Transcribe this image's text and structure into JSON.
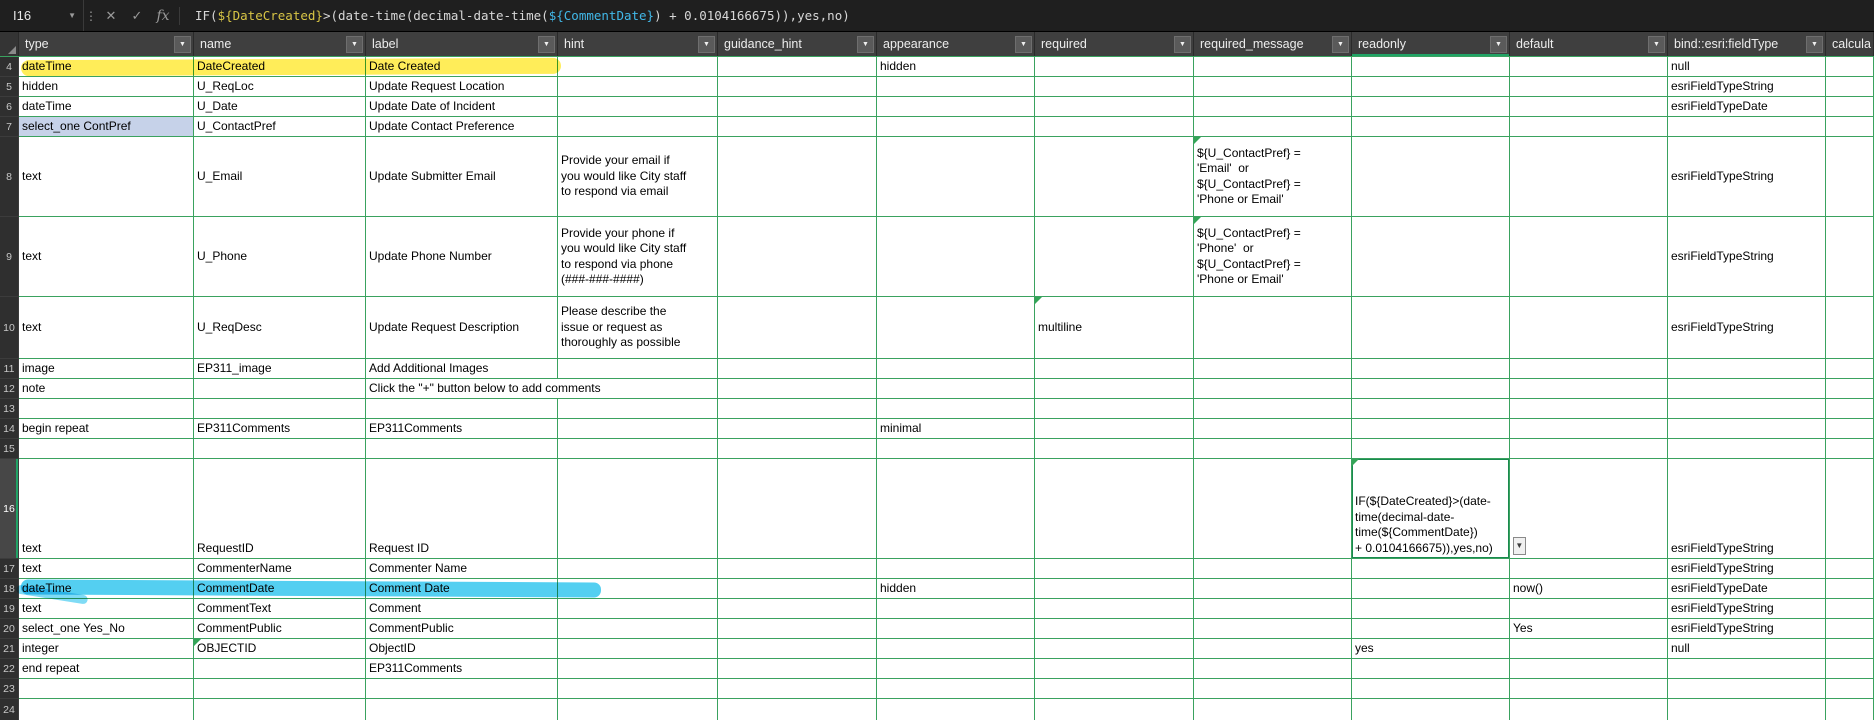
{
  "colors": {
    "grid_line": "#3aa25f",
    "yellow_marker": "#ffe619",
    "blue_marker": "#29c3ee",
    "formula_ref_datecreated": "#d8c545",
    "formula_ref_commentdate": "#41b8e8"
  },
  "formula_bar": {
    "cell_reference": "I16",
    "name_box_chevron": "▼",
    "menu_icon": "⋮",
    "cancel_icon": "✕",
    "confirm_icon": "✓",
    "function_icon": "fx",
    "formula": {
      "part1": "IF(",
      "highlight1": "${DateCreated}",
      "part2": ">(date-time(decimal-date-time(",
      "highlight2": "${CommentDate}",
      "part3": ") + 0.0104166675)),yes,no)"
    }
  },
  "header": {
    "filter_icon": "▼",
    "columns": [
      "type",
      "name",
      "label",
      "hint",
      "guidance_hint",
      "appearance",
      "required",
      "required_message",
      "readonly",
      "default",
      "bind::esri:fieldType",
      "calcula"
    ]
  },
  "sheet": {
    "validation_icon": "▼"
  },
  "rows": [
    {
      "num": "4",
      "marker": "yellow",
      "cells": [
        "dateTime",
        "DateCreated",
        "Date Created",
        "",
        "",
        "hidden",
        "",
        "",
        "",
        "",
        "null",
        ""
      ]
    },
    {
      "num": "5",
      "cells": [
        "hidden",
        "U_ReqLoc",
        "Update Request Location",
        "",
        "",
        "",
        "",
        "",
        "",
        "",
        "esriFieldTypeString",
        ""
      ]
    },
    {
      "num": "6",
      "cells": [
        "dateTime",
        "U_Date",
        "Update Date of Incident",
        "",
        "",
        "",
        "",
        "",
        "",
        "",
        "esriFieldTypeDate",
        ""
      ]
    },
    {
      "num": "7",
      "selected_type_cell": true,
      "cells": [
        "select_one ContPref",
        "U_ContactPref",
        "Update Contact Preference",
        "",
        "",
        "",
        "",
        "",
        "",
        "",
        "",
        ""
      ]
    },
    {
      "num": "8",
      "flags": [
        7
      ],
      "cells": [
        "text",
        "U_Email",
        "Update Submitter Email",
        "Provide your email if\nyou would like City staff\nto respond via email",
        "",
        "",
        "",
        "${U_ContactPref} =\n'Email'  or\n${U_ContactPref} =\n'Phone or Email'",
        "",
        "",
        "esriFieldTypeString",
        ""
      ]
    },
    {
      "num": "9",
      "flags": [
        7
      ],
      "cells": [
        "text",
        "U_Phone",
        "Update Phone Number",
        "Provide your phone if\nyou would like City staff\nto respond via phone\n(###-###-####)",
        "",
        "",
        "",
        "${U_ContactPref} =\n'Phone'  or\n${U_ContactPref} =\n'Phone or Email'",
        "",
        "",
        "esriFieldTypeString",
        ""
      ]
    },
    {
      "num": "10",
      "flags": [
        6
      ],
      "cells": [
        "text",
        "U_ReqDesc",
        "Update Request Description",
        "Please describe the\nissue or request as\nthoroughly as possible",
        "",
        "",
        "multiline",
        "",
        "",
        "",
        "esriFieldTypeString",
        ""
      ]
    },
    {
      "num": "11",
      "cells": [
        "image",
        "EP311_image",
        "Add Additional Images",
        "",
        "",
        "",
        "",
        "",
        "",
        "",
        "",
        ""
      ]
    },
    {
      "num": "12",
      "colspan": {
        "2": 2
      },
      "cells": [
        "note",
        "",
        "Click the \"+\" button below to add comments",
        "",
        "",
        "",
        "",
        "",
        "",
        "",
        "",
        ""
      ]
    },
    {
      "num": "13",
      "cells": [
        "",
        "",
        "",
        "",
        "",
        "",
        "",
        "",
        "",
        "",
        "",
        ""
      ]
    },
    {
      "num": "14",
      "cells": [
        "begin repeat",
        "EP311Comments",
        "EP311Comments",
        "",
        "",
        "minimal",
        "",
        "",
        "",
        "",
        "",
        ""
      ]
    },
    {
      "num": "15",
      "cells": [
        "",
        "",
        "",
        "",
        "",
        "",
        "",
        "",
        "",
        "",
        "",
        ""
      ]
    },
    {
      "num": "16",
      "active": true,
      "flags": [
        8
      ],
      "cells": [
        "text",
        "RequestID",
        "Request ID",
        "",
        "",
        "",
        "",
        "",
        "IF(${DateCreated}>(date-\ntime(decimal-date-\ntime(${CommentDate})\n+ 0.0104166675)),yes,no)",
        "",
        "esriFieldTypeString",
        ""
      ]
    },
    {
      "num": "17",
      "cells": [
        "text",
        "CommenterName",
        "Commenter Name",
        "",
        "",
        "",
        "",
        "",
        "",
        "",
        "esriFieldTypeString",
        ""
      ]
    },
    {
      "num": "18",
      "marker": "blue",
      "cells": [
        "dateTime",
        "CommentDate",
        "Comment Date",
        "",
        "",
        "hidden",
        "",
        "",
        "",
        "now()",
        "esriFieldTypeDate",
        ""
      ]
    },
    {
      "num": "19",
      "cells": [
        "text",
        "CommentText",
        "Comment",
        "",
        "",
        "",
        "",
        "",
        "",
        "",
        "esriFieldTypeString",
        ""
      ]
    },
    {
      "num": "20",
      "cells": [
        "select_one Yes_No",
        "CommentPublic",
        "CommentPublic",
        "",
        "",
        "",
        "",
        "",
        "",
        "Yes",
        "esriFieldTypeString",
        ""
      ]
    },
    {
      "num": "21",
      "flags": [
        1
      ],
      "cells": [
        "integer",
        "OBJECTID",
        "ObjectID",
        "",
        "",
        "",
        "",
        "",
        "yes",
        "",
        "null",
        ""
      ]
    },
    {
      "num": "22",
      "cells": [
        "end repeat",
        "",
        "EP311Comments",
        "",
        "",
        "",
        "",
        "",
        "",
        "",
        "",
        ""
      ]
    },
    {
      "num": "23",
      "cells": [
        "",
        "",
        "",
        "",
        "",
        "",
        "",
        "",
        "",
        "",
        "",
        ""
      ]
    },
    {
      "num": "24",
      "cells": [
        "",
        "",
        "",
        "",
        "",
        "",
        "",
        "",
        "",
        "",
        "",
        ""
      ]
    }
  ]
}
